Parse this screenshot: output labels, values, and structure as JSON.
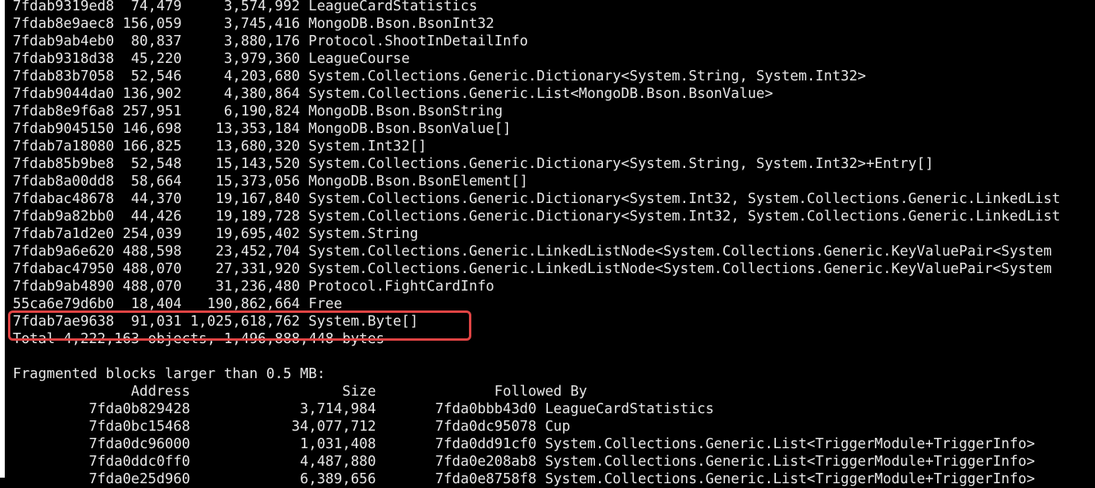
{
  "terminal": {
    "heap_rows": [
      {
        "mt": "7fdab9319ed8",
        "count": "74,479",
        "total": "3,574,992",
        "class": "LeagueCardStatistics"
      },
      {
        "mt": "7fdab8e9aec8",
        "count": "156,059",
        "total": "3,745,416",
        "class": "MongoDB.Bson.BsonInt32"
      },
      {
        "mt": "7fdab9ab4eb0",
        "count": "80,837",
        "total": "3,880,176",
        "class": "Protocol.ShootInDetailInfo"
      },
      {
        "mt": "7fdab9318d38",
        "count": "45,220",
        "total": "3,979,360",
        "class": "LeagueCourse"
      },
      {
        "mt": "7fdab83b7058",
        "count": "52,546",
        "total": "4,203,680",
        "class": "System.Collections.Generic.Dictionary<System.String, System.Int32>"
      },
      {
        "mt": "7fdab9044da0",
        "count": "136,902",
        "total": "4,380,864",
        "class": "System.Collections.Generic.List<MongoDB.Bson.BsonValue>"
      },
      {
        "mt": "7fdab8e9f6a8",
        "count": "257,951",
        "total": "6,190,824",
        "class": "MongoDB.Bson.BsonString"
      },
      {
        "mt": "7fdab9045150",
        "count": "146,698",
        "total": "13,353,184",
        "class": "MongoDB.Bson.BsonValue[]"
      },
      {
        "mt": "7fdab7a18080",
        "count": "166,825",
        "total": "13,680,320",
        "class": "System.Int32[]"
      },
      {
        "mt": "7fdab85b9be8",
        "count": "52,548",
        "total": "15,143,520",
        "class": "System.Collections.Generic.Dictionary<System.String, System.Int32>+Entry[]"
      },
      {
        "mt": "7fdab8a00dd8",
        "count": "58,664",
        "total": "15,373,056",
        "class": "MongoDB.Bson.BsonElement[]"
      },
      {
        "mt": "7fdabac48678",
        "count": "44,370",
        "total": "19,167,840",
        "class": "System.Collections.Generic.Dictionary<System.Int32, System.Collections.Generic.LinkedList"
      },
      {
        "mt": "7fdab9a82bb0",
        "count": "44,426",
        "total": "19,189,728",
        "class": "System.Collections.Generic.Dictionary<System.Int32, System.Collections.Generic.LinkedList"
      },
      {
        "mt": "7fdab7a1d2e0",
        "count": "254,039",
        "total": "19,695,402",
        "class": "System.String"
      },
      {
        "mt": "7fdab9a6e620",
        "count": "488,598",
        "total": "23,452,704",
        "class": "System.Collections.Generic.LinkedListNode<System.Collections.Generic.KeyValuePair<System"
      },
      {
        "mt": "7fdabac47950",
        "count": "488,070",
        "total": "27,331,920",
        "class": "System.Collections.Generic.LinkedListNode<System.Collections.Generic.KeyValuePair<System"
      },
      {
        "mt": "7fdab9ab4890",
        "count": "488,070",
        "total": "31,236,480",
        "class": "Protocol.FightCardInfo"
      },
      {
        "mt": "55ca6e79d6b0",
        "count": "18,404",
        "total": "190,862,664",
        "class": "Free"
      },
      {
        "mt": "7fdab7ae9638",
        "count": "91,031",
        "total": "1,025,618,762",
        "class": "System.Byte[]"
      }
    ],
    "total_line": "Total 4,222,163 objects, 1,496,888,448 bytes",
    "fragmented_title": "Fragmented blocks larger than 0.5 MB:",
    "frag_headers": {
      "address": "Address",
      "size": "Size",
      "followed_by": "Followed By"
    },
    "frag_rows": [
      {
        "address": "7fda0b829428",
        "size": "3,714,984",
        "followed": "7fda0bbb43d0",
        "class": "LeagueCardStatistics"
      },
      {
        "address": "7fda0bc15468",
        "size": "34,077,712",
        "followed": "7fda0dc95078",
        "class": "Cup"
      },
      {
        "address": "7fda0dc96000",
        "size": "1,031,408",
        "followed": "7fda0dd91cf0",
        "class": "System.Collections.Generic.List<TriggerModule+TriggerInfo>"
      },
      {
        "address": "7fda0ddc0ff0",
        "size": "4,487,880",
        "followed": "7fda0e208ab8",
        "class": "System.Collections.Generic.List<TriggerModule+TriggerInfo>"
      },
      {
        "address": "7fda0e25d960",
        "size": "6,389,656",
        "followed": "7fda0e8758f8",
        "class": "System.Collections.Generic.List<TriggerModule+TriggerInfo>"
      }
    ],
    "highlight_color": "#e04444"
  }
}
